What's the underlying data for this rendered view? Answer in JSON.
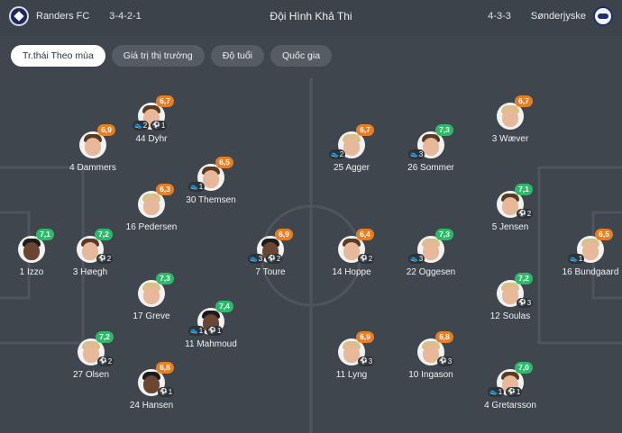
{
  "header": {
    "home_team": "Randers FC",
    "home_formation": "3-4-2-1",
    "title": "Đội Hình Khả Thi",
    "away_formation": "4-3-3",
    "away_team": "Sønderjyske"
  },
  "tabs": [
    {
      "label": "Tr.thái Theo mùa",
      "active": true
    },
    {
      "label": "Giá trị thị trường",
      "active": false
    },
    {
      "label": "Độ tuổi",
      "active": false
    },
    {
      "label": "Quốc gia",
      "active": false
    }
  ],
  "icons": {
    "assist": "boot-icon",
    "goal": "ball-icon"
  },
  "colors": {
    "rating_high": "#2fb86a",
    "rating_mid": "#e57e25",
    "tab_active": "#ffffff"
  },
  "players": [
    {
      "name": "1 Izzo",
      "rating": "7,1",
      "color": "green",
      "assists": "",
      "goals": ""
    },
    {
      "name": "3 Høegh",
      "rating": "7,2",
      "color": "green",
      "assists": "",
      "goals": "2"
    },
    {
      "name": "4 Dammers",
      "rating": "6,9",
      "color": "orange",
      "assists": "",
      "goals": ""
    },
    {
      "name": "27 Olsen",
      "rating": "7,2",
      "color": "green",
      "assists": "",
      "goals": "2"
    },
    {
      "name": "44 Dyhr",
      "rating": "6,7",
      "color": "orange",
      "assists": "2",
      "goals": "1"
    },
    {
      "name": "16 Pedersen",
      "rating": "6,3",
      "color": "orange",
      "assists": "",
      "goals": ""
    },
    {
      "name": "17 Greve",
      "rating": "7,3",
      "color": "green",
      "assists": "",
      "goals": ""
    },
    {
      "name": "24 Hansen",
      "rating": "6,8",
      "color": "orange",
      "assists": "",
      "goals": "1"
    },
    {
      "name": "30 Themsen",
      "rating": "6,5",
      "color": "orange",
      "assists": "1",
      "goals": ""
    },
    {
      "name": "11 Mahmoud",
      "rating": "7,4",
      "color": "green",
      "assists": "1",
      "goals": "1"
    },
    {
      "name": "7 Toure",
      "rating": "6,9",
      "color": "orange",
      "assists": "3",
      "goals": "2"
    },
    {
      "name": "25 Agger",
      "rating": "6,7",
      "color": "orange",
      "assists": "2",
      "goals": ""
    },
    {
      "name": "14 Hoppe",
      "rating": "6,4",
      "color": "orange",
      "assists": "",
      "goals": "2"
    },
    {
      "name": "11 Lyng",
      "rating": "6,9",
      "color": "orange",
      "assists": "",
      "goals": "3"
    },
    {
      "name": "26 Sommer",
      "rating": "7,3",
      "color": "green",
      "assists": "3",
      "goals": ""
    },
    {
      "name": "22 Oggesen",
      "rating": "7,3",
      "color": "green",
      "assists": "3",
      "goals": ""
    },
    {
      "name": "10 Ingason",
      "rating": "6,8",
      "color": "orange",
      "assists": "",
      "goals": "3"
    },
    {
      "name": "3 Wæver",
      "rating": "6,7",
      "color": "orange",
      "assists": "",
      "goals": ""
    },
    {
      "name": "5 Jensen",
      "rating": "7,1",
      "color": "green",
      "assists": "",
      "goals": "2"
    },
    {
      "name": "12 Soulas",
      "rating": "7,2",
      "color": "green",
      "assists": "",
      "goals": "3"
    },
    {
      "name": "4 Gretarsson",
      "rating": "7,0",
      "color": "green",
      "assists": "1",
      "goals": "1"
    },
    {
      "name": "16 Bundgaard",
      "rating": "6,5",
      "color": "orange",
      "assists": "1",
      "goals": ""
    }
  ]
}
